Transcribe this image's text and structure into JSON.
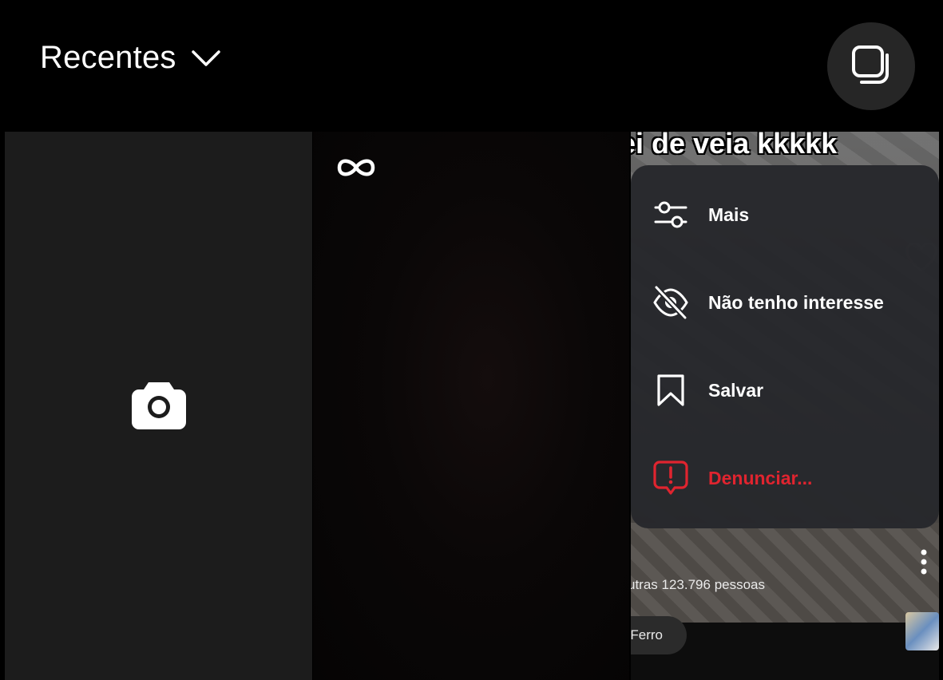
{
  "header": {
    "album_label": "Recentes",
    "album_icon": "chevron-down-icon",
    "multi_select_icon": "multi-select-icon"
  },
  "grid": {
    "camera_tile": {
      "icon": "camera-icon"
    },
    "boomerang_tile": {
      "icon": "infinity-icon"
    },
    "video_tile": {
      "caption": "ei de veia kkkkk",
      "likes_text": "utras 123.796 pessoas",
      "music_label": "Ferro",
      "context_menu": {
        "items": [
          {
            "label": "Mais",
            "icon": "sliders-icon"
          },
          {
            "label": "Não tenho interesse",
            "icon": "eye-off-icon"
          },
          {
            "label": "Salvar",
            "icon": "bookmark-icon"
          },
          {
            "label": "Denunciar...",
            "icon": "report-icon",
            "color": "#e0242f"
          }
        ]
      }
    }
  }
}
